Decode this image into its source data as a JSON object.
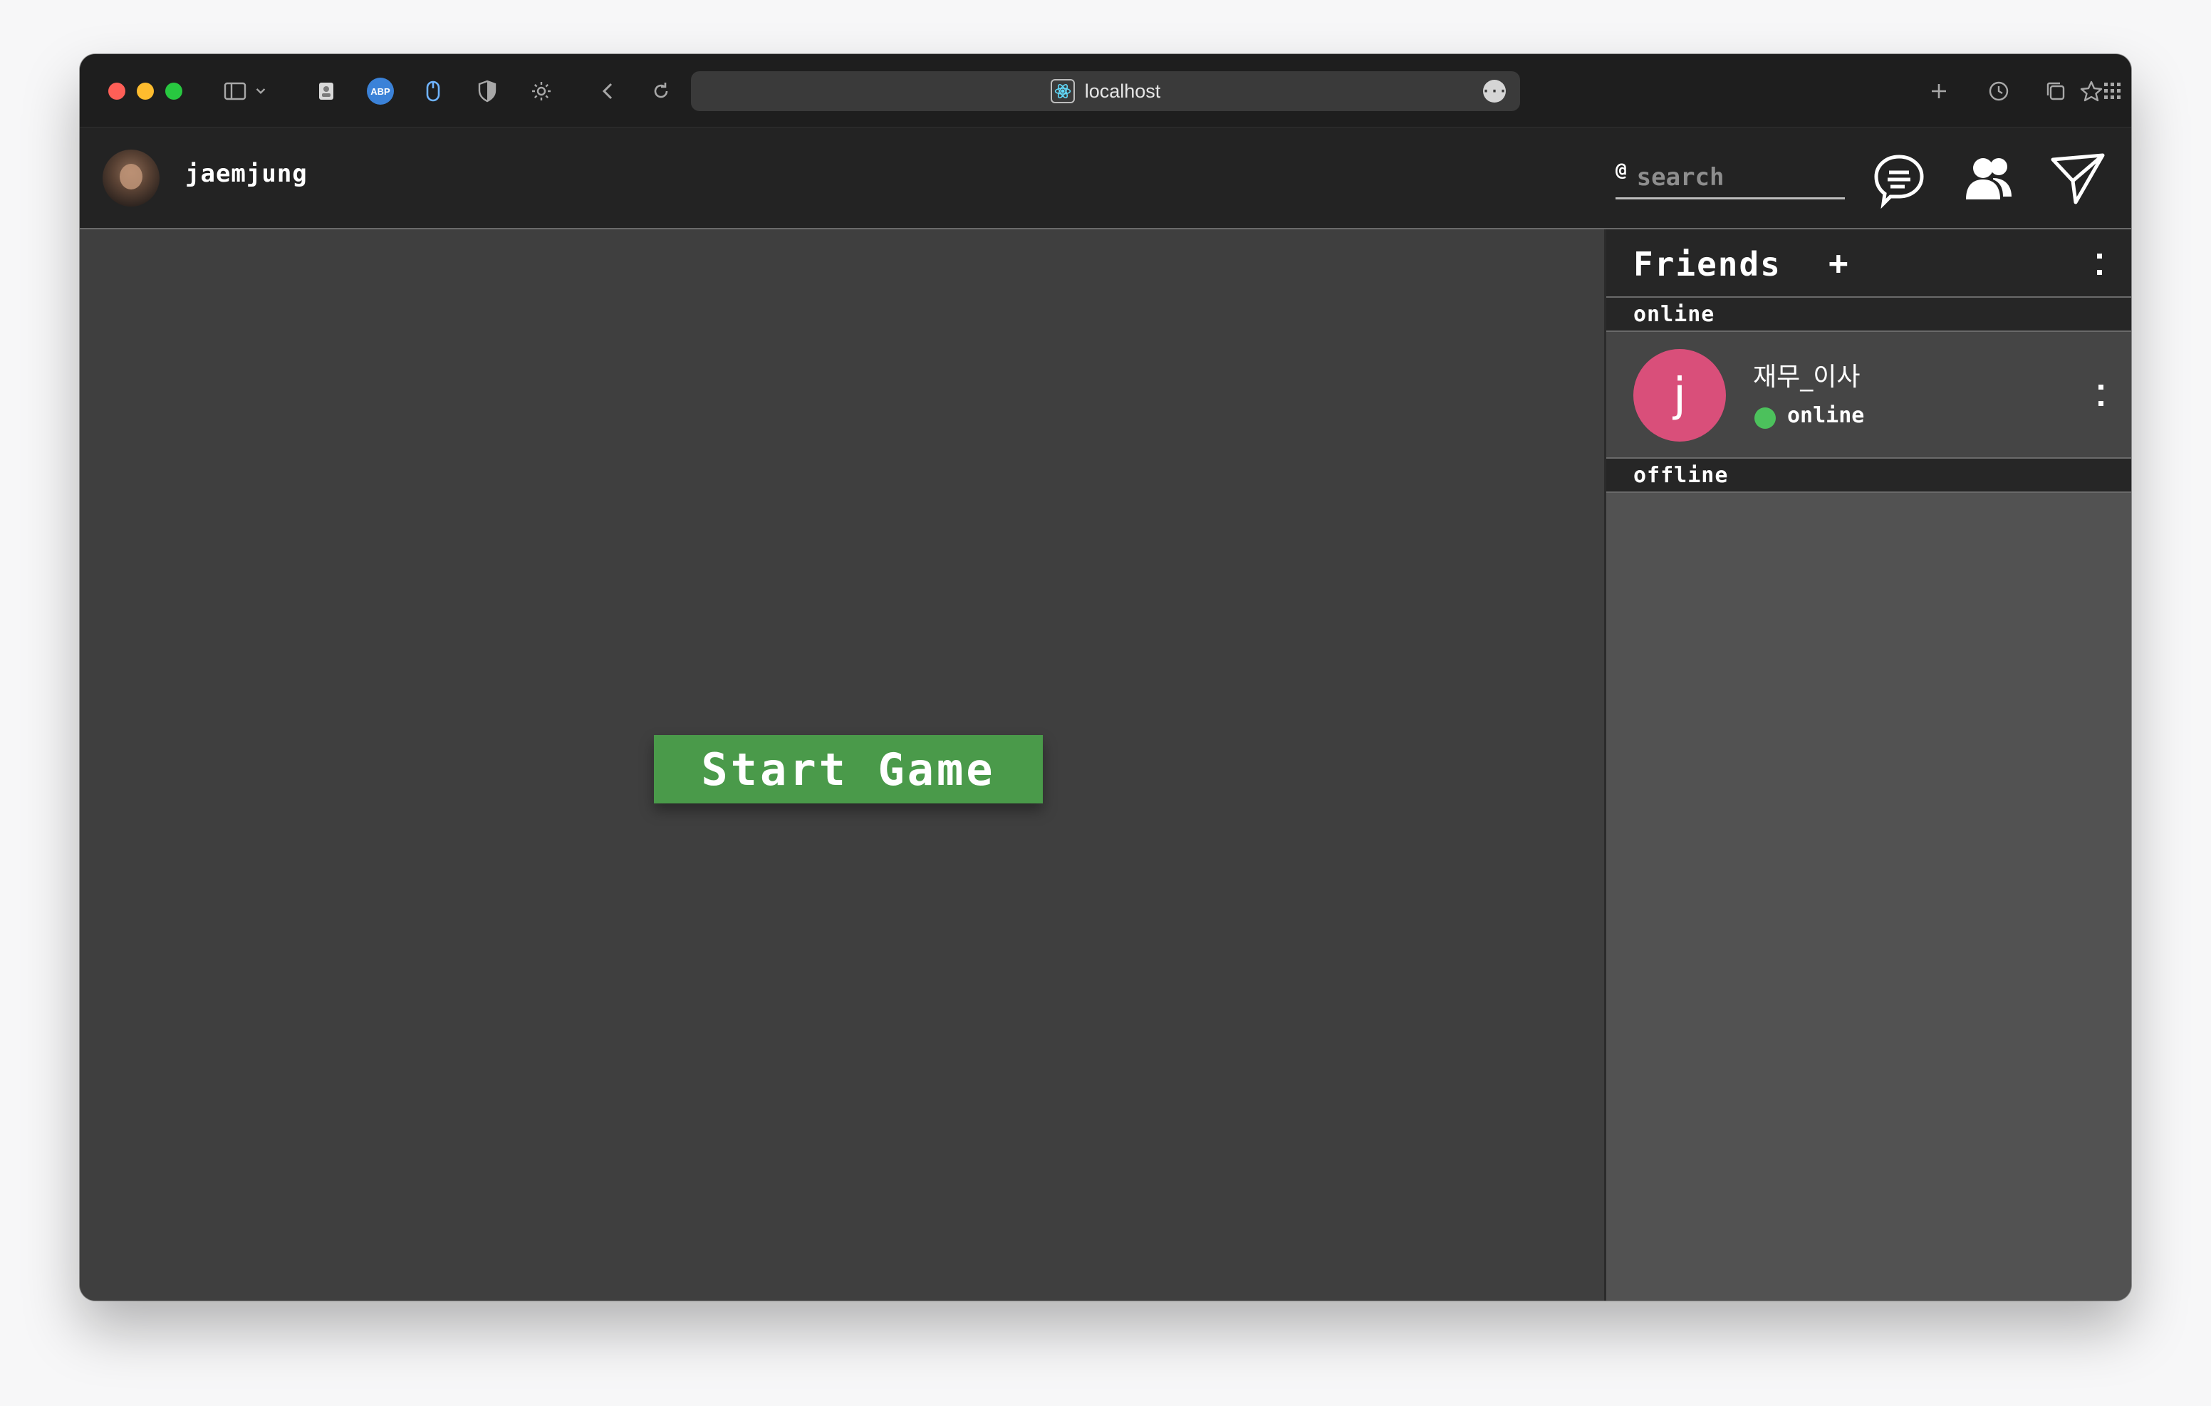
{
  "browser": {
    "url": "localhost",
    "abp_label": "ABP"
  },
  "header": {
    "username": "jaemjung",
    "search": {
      "prefix": "@",
      "placeholder": "search"
    }
  },
  "main": {
    "start_button": "Start Game"
  },
  "friends": {
    "title": "Friends",
    "add_label": "+",
    "sections": {
      "online": "online",
      "offline": "offline"
    },
    "items": [
      {
        "avatar_letter": "j",
        "name": "재무_이사",
        "status": "online",
        "avatar_color": "#d94f7a",
        "status_color": "#4cc15c"
      }
    ]
  },
  "colors": {
    "start_button": "#4a9a4a",
    "header_bg": "#232323",
    "game_bg": "#3f3f3f",
    "sidebar_bg": "#525252"
  }
}
